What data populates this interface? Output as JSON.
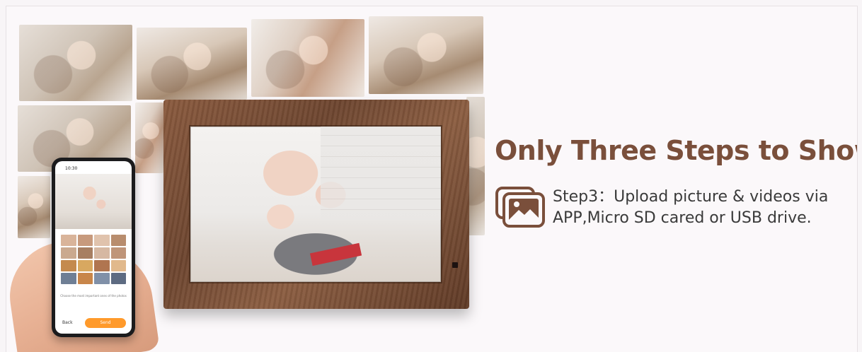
{
  "headline": "Only Three Steps to Show",
  "step": {
    "line1": "Step3：Upload picture & videos via",
    "line2": "APP,Micro SD cared or USB drive."
  },
  "phone": {
    "time": "10:30",
    "caption": "Choose the most important ones of the photos",
    "back_label": "Back",
    "send_label": "Send"
  },
  "colors": {
    "headline": "#7a4f3b",
    "icon": "#7a4f3b",
    "frame_wood": "#6e4630",
    "send_button": "#ff9a2b"
  },
  "icons": [
    "photo-gallery-icon"
  ]
}
